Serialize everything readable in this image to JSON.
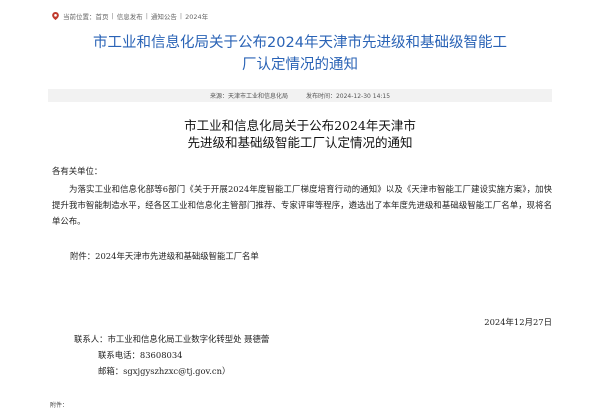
{
  "breadcrumb": {
    "prefix": "当前位置：",
    "items": [
      "首页",
      "信息发布",
      "通知公告",
      "2024年"
    ]
  },
  "title": {
    "line1": "市工业和信息化局关于公布2024年天津市先进级和基础级智能工",
    "line2": "厂认定情况的通知"
  },
  "meta": {
    "source_label": "来源：",
    "source_value": "天津市工业和信息化局",
    "date_label": "发布时间：",
    "date_value": "2024-12-30 14:15"
  },
  "doc_title": {
    "line1": "市工业和信息化局关于公布2024年天津市",
    "line2": "先进级和基础级智能工厂认定情况的通知"
  },
  "body": {
    "salutation": "各有关单位：",
    "paragraph": "为落实工业和信息化部等6部门《关于开展2024年度智能工厂梯度培育行动的通知》以及《天津市智能工厂建设实施方案》，加快提升我市智能制造水平，经各区工业和信息化主管部门推荐、专家评审等程序，遴选出了本年度先进级和基础级智能工厂名单，现将名单公布。",
    "attachment": "附件：2024年天津市先进级和基础级智能工厂名单",
    "date": "2024年12月27日"
  },
  "contact": {
    "person_label": "联系人：",
    "person_value": "市工业和信息化局工业数字化转型处 聂德蕾",
    "phone_label": "联系电话：",
    "phone_value": "83608034",
    "email_label": "邮箱：",
    "email_value": "sgxjgyszhzxc@tj.gov.cn）"
  },
  "footer": {
    "attachments_label": "附件："
  },
  "colors": {
    "title_blue": "#2a63b6",
    "meta_bg": "#f2f2f2"
  }
}
